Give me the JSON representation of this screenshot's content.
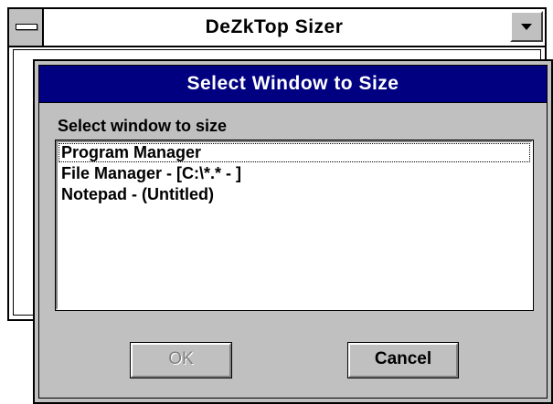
{
  "back_window": {
    "title": "DeZkTop Sizer",
    "system_menu_icon": "system-menu-bar-icon",
    "minimize_icon": "minimize-arrow-icon"
  },
  "dialog": {
    "title": "Select Window to Size",
    "prompt": "Select window to size",
    "windows": [
      {
        "label": "Program Manager",
        "focused": true
      },
      {
        "label": "File Manager - [C:\\*.* - ]",
        "focused": false
      },
      {
        "label": "Notepad - (Untitled)",
        "focused": false
      }
    ],
    "ok_label": "OK",
    "ok_enabled": false,
    "cancel_label": "Cancel"
  },
  "colors": {
    "title_bar_active": "#000080",
    "dialog_face": "#c0c0c0",
    "disabled_text": "#808080"
  }
}
